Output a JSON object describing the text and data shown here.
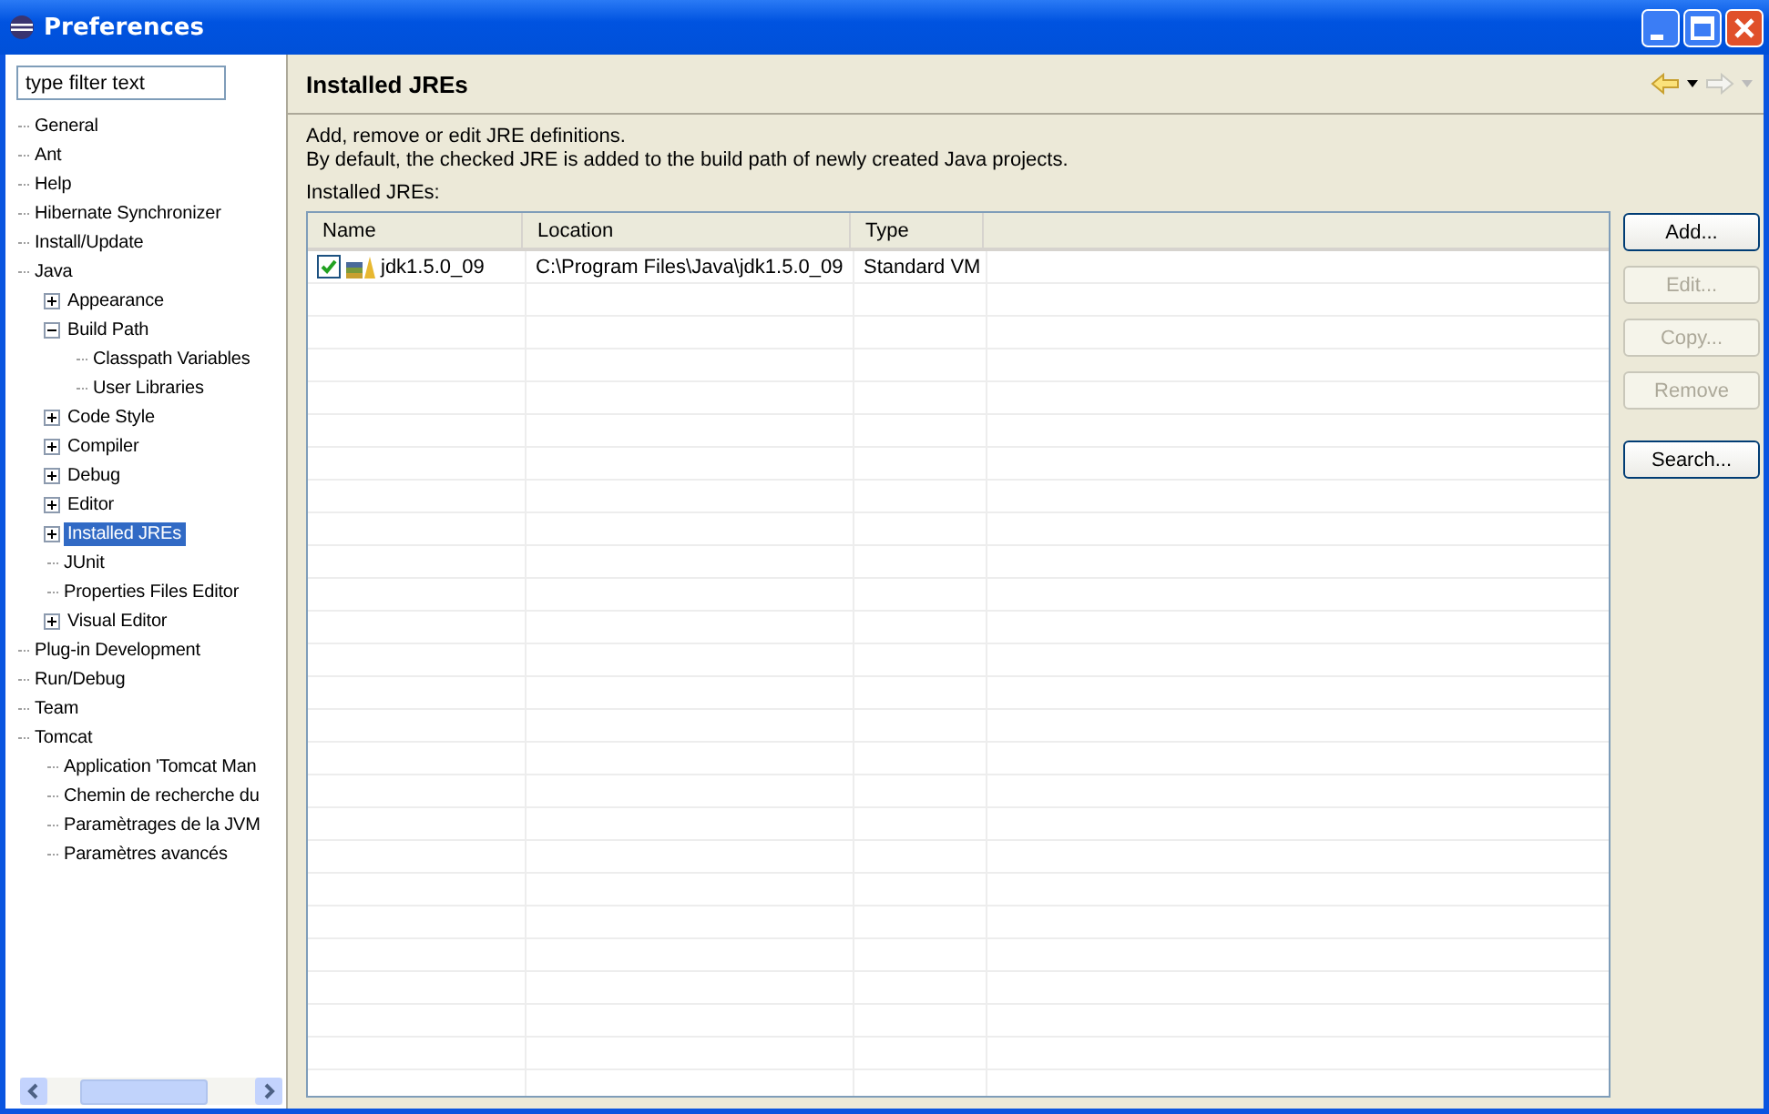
{
  "window": {
    "title": "Preferences"
  },
  "filter": {
    "placeholder": "type filter text"
  },
  "tree": [
    {
      "label": "General",
      "selected": false
    },
    {
      "label": "Ant",
      "selected": false
    },
    {
      "label": "Help",
      "selected": false
    },
    {
      "label": "Hibernate Synchronizer",
      "selected": false
    },
    {
      "label": "Install/Update",
      "selected": false
    },
    {
      "label": "Java",
      "selected": false,
      "children": [
        {
          "label": "Appearance",
          "selected": false,
          "expanded": false
        },
        {
          "label": "Build Path",
          "selected": false,
          "expanded": true,
          "children": [
            {
              "label": "Classpath Variables",
              "selected": false
            },
            {
              "label": "User Libraries",
              "selected": false
            }
          ]
        },
        {
          "label": "Code Style",
          "selected": false,
          "expanded": false
        },
        {
          "label": "Compiler",
          "selected": false,
          "expanded": false
        },
        {
          "label": "Debug",
          "selected": false,
          "expanded": false
        },
        {
          "label": "Editor",
          "selected": false,
          "expanded": false
        },
        {
          "label": "Installed JREs",
          "selected": true,
          "expanded": false
        },
        {
          "label": "JUnit",
          "selected": false
        },
        {
          "label": "Properties Files Editor",
          "selected": false
        },
        {
          "label": "Visual Editor",
          "selected": false,
          "expanded": false
        }
      ]
    },
    {
      "label": "Plug-in Development",
      "selected": false
    },
    {
      "label": "Run/Debug",
      "selected": false
    },
    {
      "label": "Team",
      "selected": false
    },
    {
      "label": "Tomcat",
      "selected": false,
      "children": [
        {
          "label": "Application 'Tomcat Man",
          "selected": false
        },
        {
          "label": "Chemin de recherche du",
          "selected": false
        },
        {
          "label": "Paramètrages de la JVM",
          "selected": false
        },
        {
          "label": "Paramètres avancés",
          "selected": false
        }
      ]
    }
  ],
  "page": {
    "title": "Installed JREs",
    "description": [
      "Add, remove or edit JRE definitions.",
      "By default, the checked JRE is added to the build path of newly created Java projects."
    ],
    "table_label": "Installed JREs:"
  },
  "table": {
    "columns": [
      "Name",
      "Location",
      "Type"
    ],
    "rows": [
      {
        "checked": true,
        "name": "jdk1.5.0_09",
        "location": "C:\\Program Files\\Java\\jdk1.5.0_09",
        "type": "Standard VM"
      }
    ]
  },
  "buttons": [
    {
      "label": "Add...",
      "disabled": false
    },
    {
      "label": "Edit...",
      "disabled": true
    },
    {
      "label": "Copy...",
      "disabled": true
    },
    {
      "label": "Remove",
      "disabled": true
    },
    {
      "label": "Search...",
      "disabled": false
    }
  ]
}
